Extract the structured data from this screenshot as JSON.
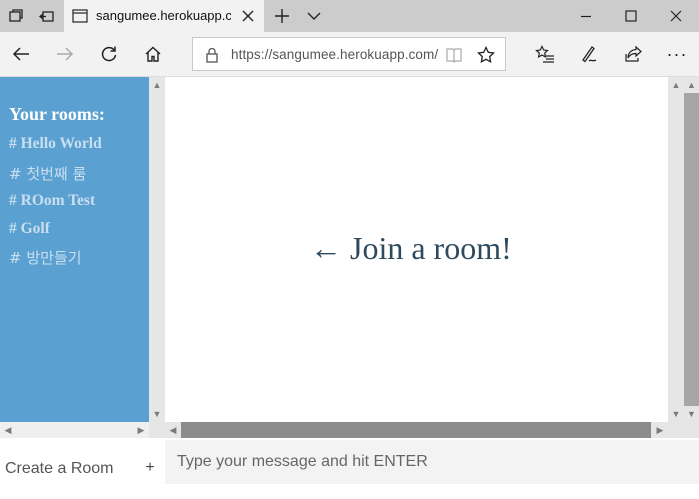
{
  "browser": {
    "tab_title": "sangumee.herokuapp.co",
    "url": "https://sangumee.herokuapp.com/",
    "more_label": "···"
  },
  "sidebar": {
    "heading": "Your rooms:",
    "rooms": [
      {
        "label": "# Hello World"
      },
      {
        "label": "# 첫번째 룸"
      },
      {
        "label": "# ROom Test"
      },
      {
        "label": "# Golf"
      },
      {
        "label": "# 방만들기"
      }
    ]
  },
  "main": {
    "join_message": "← Join a room!"
  },
  "create_room": {
    "label": "Create a Room",
    "button": "+"
  },
  "message": {
    "placeholder": "Type your message and hit ENTER",
    "value": ""
  },
  "colors": {
    "sidebar_bg": "#5aa0d0",
    "room_link": "#c9dff0",
    "heading": "#ffffff",
    "join_text": "#2e4a5e"
  }
}
